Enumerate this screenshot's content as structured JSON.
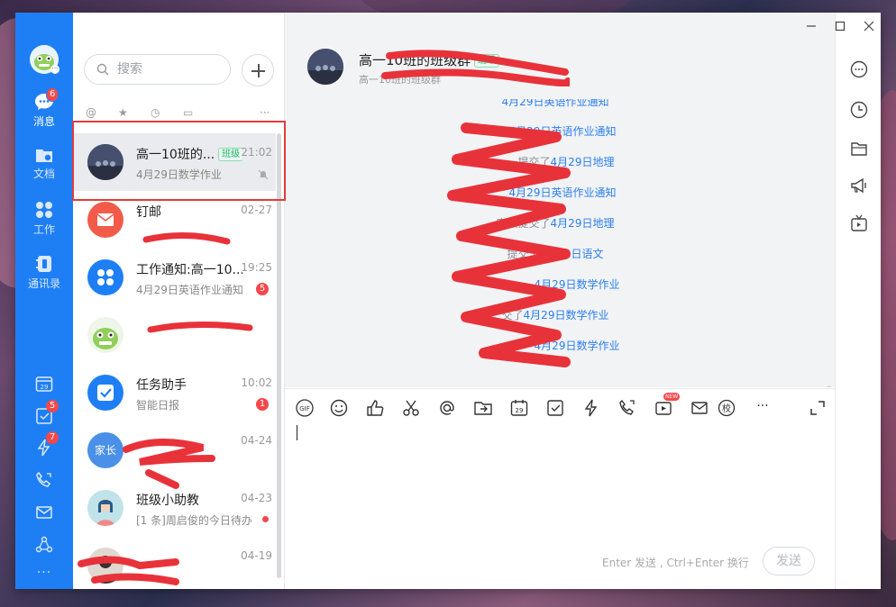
{
  "rail": {
    "items": [
      {
        "label": "消息",
        "badge": "6"
      },
      {
        "label": "文档",
        "badge": ""
      },
      {
        "label": "工作",
        "badge": ""
      },
      {
        "label": "通讯录",
        "badge": ""
      }
    ],
    "bottom_badges": {
      "todo": "5",
      "ding": "7"
    },
    "calendar_day": "29"
  },
  "search": {
    "placeholder": "搜索"
  },
  "conversations": [
    {
      "name": "高一10班的...",
      "tag": "班级",
      "time": "21:02",
      "preview": "4月29日数学作业",
      "badge": ""
    },
    {
      "name": "钉邮",
      "tag": "",
      "time": "02-27",
      "preview": "",
      "badge": ""
    },
    {
      "name": "工作通知:高一10...",
      "tag": "",
      "time": "19:25",
      "preview": "4月29日英语作业通知",
      "badge": "5"
    },
    {
      "name": "",
      "tag": "",
      "time": "",
      "preview": "",
      "badge": ""
    },
    {
      "name": "任务助手",
      "tag": "",
      "time": "10:02",
      "preview": "智能日报",
      "badge": "1"
    },
    {
      "name": "",
      "tag": "",
      "time": "04-24",
      "preview": "",
      "badge": "",
      "avatar_text": "家长"
    },
    {
      "name": "班级小助教",
      "tag": "",
      "time": "04-23",
      "preview": "[1 条]周启俊的今日待办",
      "badge": ""
    },
    {
      "name": "",
      "tag": "",
      "time": "04-19",
      "preview": "",
      "badge": ""
    }
  ],
  "chat": {
    "title": "高一10班的班级群",
    "title_tag": "班级",
    "subtitle": "高一10班的班级群",
    "messages": [
      {
        "prefix": "",
        "link": "4月29日英语作业通知"
      },
      {
        "prefix": "",
        "link": "4月29日英语作业通知"
      },
      {
        "prefix": "提交了",
        "link": "4月29日地理"
      },
      {
        "prefix": "",
        "link": "4月29日英语作业通知"
      },
      {
        "prefix": "家长提交了",
        "link": "4月29日地理"
      },
      {
        "prefix": "提交了",
        "link": "4月29日语文"
      },
      {
        "prefix": "",
        "link": "4月29日数学作业"
      },
      {
        "prefix": "交了",
        "link": "4月29日数学作业"
      },
      {
        "prefix": "",
        "link": "4月29日数学作业"
      }
    ],
    "input_hint": "Enter 发送 , Ctrl+Enter 换行",
    "send_label": "发送",
    "new_tag": "NEW",
    "gif_label": "GIF",
    "calendar_tool": "29",
    "school_tool": "校"
  }
}
